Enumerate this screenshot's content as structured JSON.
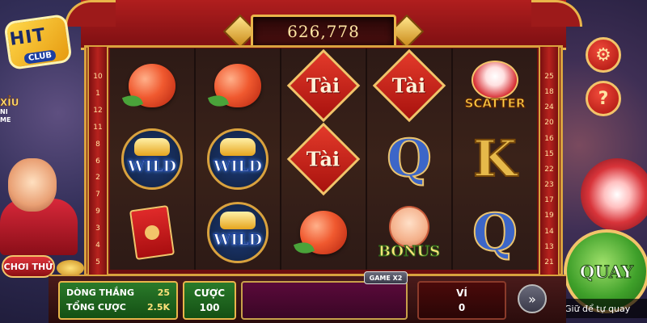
{
  "logo": {
    "main": "HIT",
    "sub": "CLUB"
  },
  "jackpot": {
    "value": "626,778"
  },
  "paylines": {
    "left": [
      "10",
      "1",
      "12",
      "11",
      "8",
      "6",
      "2",
      "7",
      "9",
      "3",
      "4",
      "5"
    ],
    "right": [
      "25",
      "18",
      "24",
      "20",
      "16",
      "15",
      "22",
      "23",
      "17",
      "19",
      "14",
      "13",
      "21"
    ]
  },
  "reels": [
    [
      "peach",
      "wild",
      "envelope"
    ],
    [
      "peach",
      "wild",
      "wild"
    ],
    [
      "tai",
      "tai",
      "peach"
    ],
    [
      "tai",
      "q",
      "bonus"
    ],
    [
      "scatter",
      "k",
      "q"
    ]
  ],
  "symbol_labels": {
    "tai": "Tài",
    "wild": "WILD",
    "scatter": "SCATTER",
    "bonus": "BONUS",
    "q": "Q",
    "k": "K"
  },
  "minigame": {
    "title": "XỈU",
    "sub1": "NI",
    "sub2": "ME"
  },
  "trial_button": "CHƠI THỬ",
  "settings_icon": "gear-icon",
  "help_icon": "question-icon",
  "help_label": "?",
  "spin_button": "QUAY",
  "auto_hint": "Giữ để tự quay",
  "game_multiplier": "GAME X2",
  "bottom": {
    "lines_label": "DÒNG THẮNG",
    "lines_value": "25",
    "total_bet_label": "TỔNG CƯỢC",
    "total_bet_value": "2.5K",
    "bet_label": "CƯỢC",
    "bet_value": "100",
    "wallet_label": "VÍ",
    "wallet_value": "0"
  }
}
